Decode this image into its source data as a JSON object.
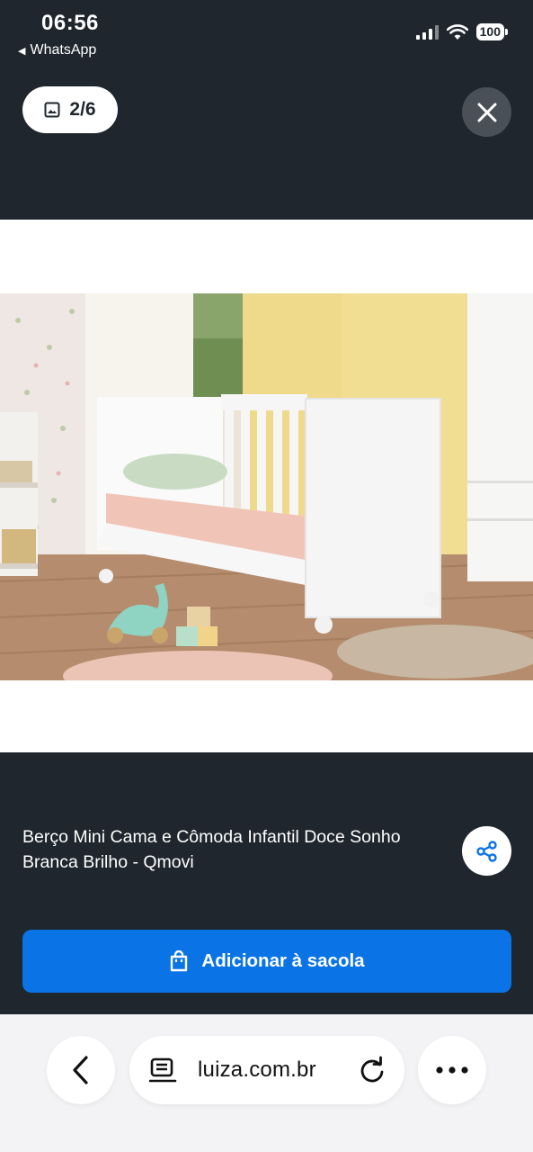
{
  "status_bar": {
    "time": "06:56",
    "back_app": "WhatsApp",
    "battery": "100"
  },
  "gallery": {
    "counter": "2/6",
    "close_icon": "close-icon",
    "image_icon": "image-icon"
  },
  "product": {
    "title": "Berço Mini Cama e Cômoda Infantil Doce Sonho Branca Brilho - Qmovi",
    "share_icon": "share-icon",
    "add_button_label": "Adicionar à sacola",
    "bag_icon": "shopping-bag-icon"
  },
  "browser": {
    "url": "luiza.com.br",
    "back_icon": "chevron-left-icon",
    "page_icon": "page-info-icon",
    "reload_icon": "reload-icon",
    "more_icon": "more-dots-icon"
  },
  "colors": {
    "background": "#1f262d",
    "primary_button": "#0a74e6",
    "photo_background": "#ffffff"
  }
}
